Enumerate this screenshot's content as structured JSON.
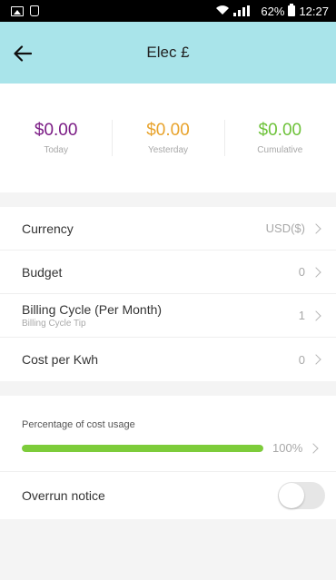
{
  "status_bar": {
    "left_icons": [
      "gallery-icon",
      "clipboard-icon"
    ],
    "battery_pct": "62%",
    "time": "12:27"
  },
  "header": {
    "title": "Elec £",
    "back_icon": "arrow-left-icon",
    "background": "#a9e4ea"
  },
  "stats": [
    {
      "value": "$0.00",
      "label": "Today",
      "color": "#7b1c85"
    },
    {
      "value": "$0.00",
      "label": "Yesterday",
      "color": "#e8a32c"
    },
    {
      "value": "$0.00",
      "label": "Cumulative",
      "color": "#6ec23a"
    }
  ],
  "settings": [
    {
      "label": "Currency",
      "value": "USD($)"
    },
    {
      "label": "Budget",
      "value": "0"
    },
    {
      "label": "Billing Cycle (Per Month)",
      "sublabel": "Billing Cycle Tip",
      "value": "1"
    },
    {
      "label": "Cost per Kwh",
      "value": "0"
    }
  ],
  "usage": {
    "label": "Percentage of cost usage",
    "percent_text": "100%",
    "fraction": 1.0,
    "bar_color": "#7dcc3a"
  },
  "overrun": {
    "label": "Overrun notice",
    "enabled": false
  }
}
